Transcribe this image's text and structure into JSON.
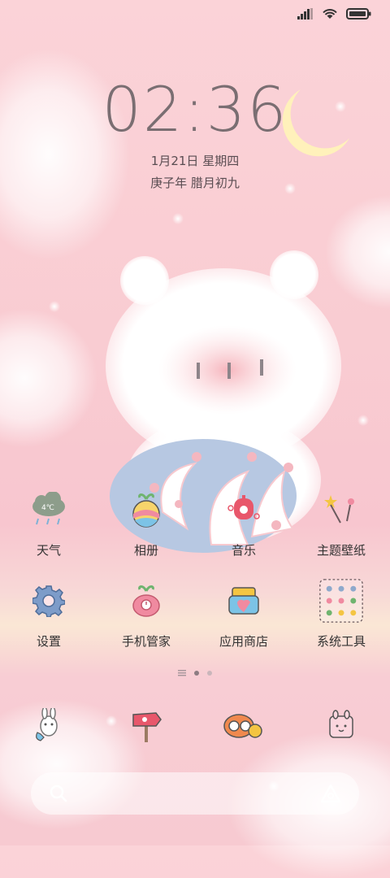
{
  "status_bar": {
    "signal": "signal-icon",
    "wifi": "wifi-icon",
    "battery": "battery-icon"
  },
  "clock": {
    "time": "02:36",
    "date": "1月21日 星期四",
    "lunar": "庚子年 腊月初九"
  },
  "apps_row1": [
    {
      "label": "天气",
      "icon": "weather-icon"
    },
    {
      "label": "相册",
      "icon": "gallery-icon"
    },
    {
      "label": "音乐",
      "icon": "music-icon"
    },
    {
      "label": "主题壁纸",
      "icon": "theme-icon"
    }
  ],
  "apps_row2": [
    {
      "label": "设置",
      "icon": "settings-icon"
    },
    {
      "label": "手机管家",
      "icon": "security-icon"
    },
    {
      "label": "应用商店",
      "icon": "app-store-icon"
    },
    {
      "label": "系统工具",
      "icon": "system-tools-folder-icon"
    }
  ],
  "weather_badge": "4℃",
  "dock": [
    {
      "icon": "phone-icon"
    },
    {
      "icon": "browser-icon"
    },
    {
      "icon": "camera-icon"
    },
    {
      "icon": "messages-icon"
    }
  ],
  "search": {
    "icon": "search-icon",
    "assistant_icon": "assistant-icon"
  },
  "colors": {
    "background": "#fbd3d8",
    "clock": "#7a6e72",
    "accent": "#e8657a"
  }
}
